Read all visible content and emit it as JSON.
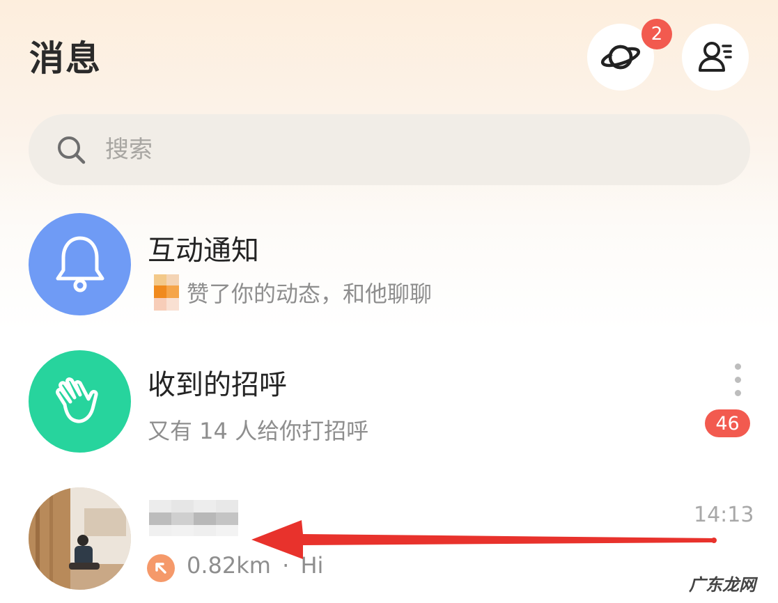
{
  "header": {
    "title": "消息",
    "discover_badge": "2"
  },
  "search": {
    "placeholder": "搜索"
  },
  "rows": [
    {
      "title": "互动通知",
      "subtitle": "赞了你的动态，和他聊聊",
      "avatar_color": "#6f9bf5",
      "icon": "bell-icon"
    },
    {
      "title": "收到的招呼",
      "subtitle": "又有 14 人给你打招呼",
      "badge": "46",
      "avatar_color": "#27d49d",
      "icon": "waving-hand-icon"
    },
    {
      "title": "",
      "time": "14:13",
      "distance": "0.82km",
      "separator": "·",
      "message": "Hi",
      "icon": "location-arrow-icon"
    }
  ],
  "annotation": {
    "arrow_color": "#e8322c"
  },
  "watermark": "广东龙网",
  "colors": {
    "badge": "#f25a4f",
    "accent_orange": "#f5996a"
  }
}
